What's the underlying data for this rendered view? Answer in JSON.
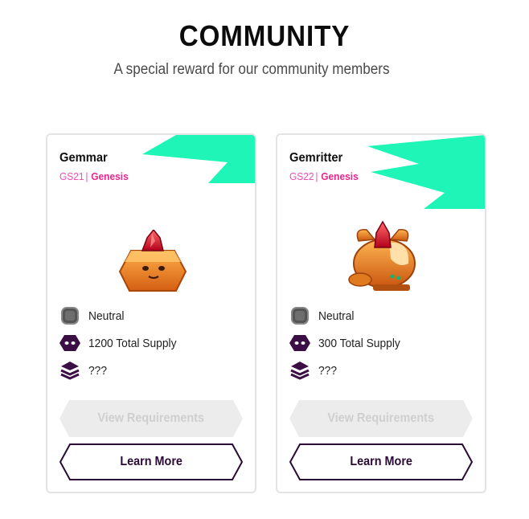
{
  "section": {
    "title": "COMMUNITY",
    "subtitle": "A special reward for our community members"
  },
  "colors": {
    "accent_mint": "#1ef5b7",
    "accent_pink": "#e6288f",
    "dark_purple": "#2b0b35",
    "disabled_gray": "#ececec"
  },
  "cards": [
    {
      "name": "Gemmar",
      "code": "GS21",
      "separator": "|",
      "series": "Genesis",
      "image": "gemmar-creature-image",
      "attributes": [
        {
          "icon": "neutral-gem-icon",
          "label": "Neutral"
        },
        {
          "icon": "supply-icon",
          "label": "1200 Total Supply"
        },
        {
          "icon": "layers-icon",
          "label": "???"
        }
      ],
      "requirements_label": "View Requirements",
      "learn_more_label": "Learn More"
    },
    {
      "name": "Gemritter",
      "code": "GS22",
      "separator": "|",
      "series": "Genesis",
      "image": "gemritter-creature-image",
      "attributes": [
        {
          "icon": "neutral-gem-icon",
          "label": "Neutral"
        },
        {
          "icon": "supply-icon",
          "label": "300 Total Supply"
        },
        {
          "icon": "layers-icon",
          "label": "???"
        }
      ],
      "requirements_label": "View Requirements",
      "learn_more_label": "Learn More"
    }
  ]
}
